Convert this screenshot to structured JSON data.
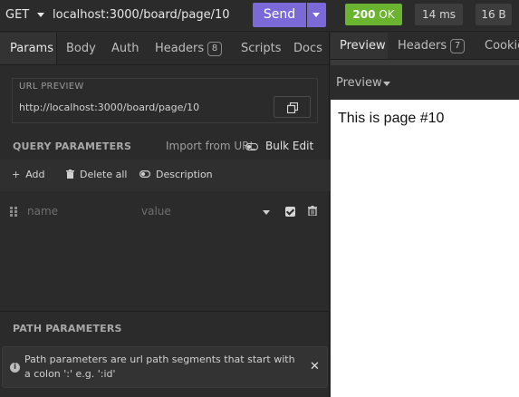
{
  "request": {
    "method": "GET",
    "url": "localhost:3000/board/page/10",
    "send_label": "Send"
  },
  "tabs": {
    "params": "Params",
    "body": "Body",
    "auth": "Auth",
    "headers": "Headers",
    "headers_count": "8",
    "scripts": "Scripts",
    "docs": "Docs"
  },
  "url_preview": {
    "title": "URL PREVIEW",
    "value": "http://localhost:3000/board/page/10"
  },
  "query_params": {
    "title": "QUERY PARAMETERS",
    "import_label": "Import from URL",
    "bulk_label": "Bulk Edit",
    "add_label": "Add",
    "delete_all_label": "Delete all",
    "description_label": "Description",
    "row": {
      "name_placeholder": "name",
      "value_placeholder": "value",
      "enabled": true
    }
  },
  "path_params": {
    "title": "PATH PARAMETERS",
    "info": "Path parameters are url path segments that start with a colon ':' e.g. ':id'"
  },
  "response": {
    "status_code": "200",
    "status_text": "OK",
    "time": "14 ms",
    "size": "16 B",
    "tabs": {
      "preview": "Preview",
      "headers": "Headers",
      "headers_count": "7",
      "cookies": "Cookie"
    },
    "view_mode": "Preview",
    "body_text": "This is page #10"
  },
  "colors": {
    "send": "#7c69d8",
    "status_ok": "#6bb430",
    "background": "#2b2b2b"
  }
}
